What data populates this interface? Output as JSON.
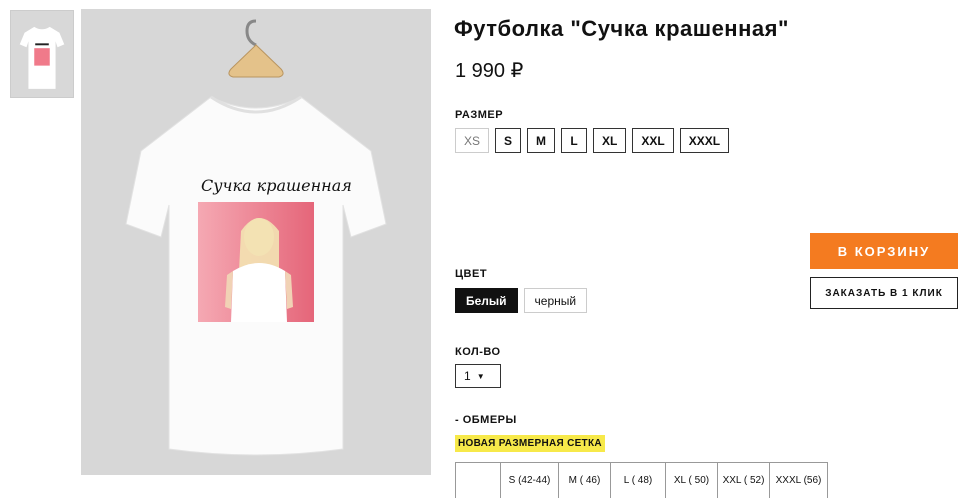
{
  "product": {
    "title": "Футболка \"Сучка крашенная\"",
    "price": "1 990 ₽",
    "print_text": "Сучка крашенная"
  },
  "size": {
    "label": "РАЗМЕР",
    "options": [
      "XS",
      "S",
      "M",
      "L",
      "XL",
      "XXL",
      "XXXL"
    ]
  },
  "color": {
    "label": "ЦВЕТ",
    "options": [
      "Белый",
      "черный"
    ],
    "selected": "Белый"
  },
  "quantity": {
    "label": "КОЛ-ВО",
    "value": "1"
  },
  "actions": {
    "cart": "В КОРЗИНУ",
    "one_click": "ЗАКАЗАТЬ В 1 КЛИК"
  },
  "measurements": {
    "toggle": "- ОБМЕРЫ",
    "new_chart": "НОВАЯ РАЗМЕРНАЯ СЕТКА",
    "columns": [
      "S (42-44)",
      "M ( 46)",
      "L ( 48)",
      "XL ( 50)",
      "XXL ( 52)",
      "XXXL (56)"
    ]
  },
  "colors": {
    "accent": "#f47b20",
    "highlight": "#f7e94a",
    "active_color_bg": "#111111",
    "photo_bg": "#d7d7d7",
    "print_pink": "#f07a8a"
  }
}
